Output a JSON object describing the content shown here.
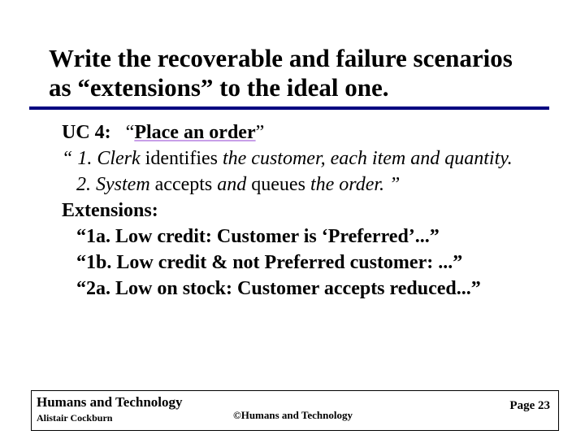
{
  "title": {
    "text": "Write the recoverable and failure scenarios as “extensions” to the ideal one."
  },
  "body": {
    "uc_label": "UC 4:",
    "uc_title_open": "“",
    "uc_title": "Place an order",
    "uc_title_close": "”",
    "step1_open": "“ 1. Clerk ",
    "step1_kw": "identifies",
    "step1_rest": " the customer, each item and quantity.",
    "step2_a": "2. System ",
    "step2_kw1": "accepts",
    "step2_mid": " and ",
    "step2_kw2": "queues",
    "step2_end": " the order. ”",
    "ext_label": "Extensions:",
    "ext1a": "“1a. Low credit:  Customer is ‘Preferred’...”",
    "ext1b": "“1b. Low credit & not Preferred customer: ...”",
    "ext2a": "“2a. Low on stock:  Customer accepts reduced...”"
  },
  "footer": {
    "org": "Humans and Technology",
    "author": "Alistair Cockburn",
    "copyright": "©Humans and Technology",
    "page": "Page 23"
  }
}
